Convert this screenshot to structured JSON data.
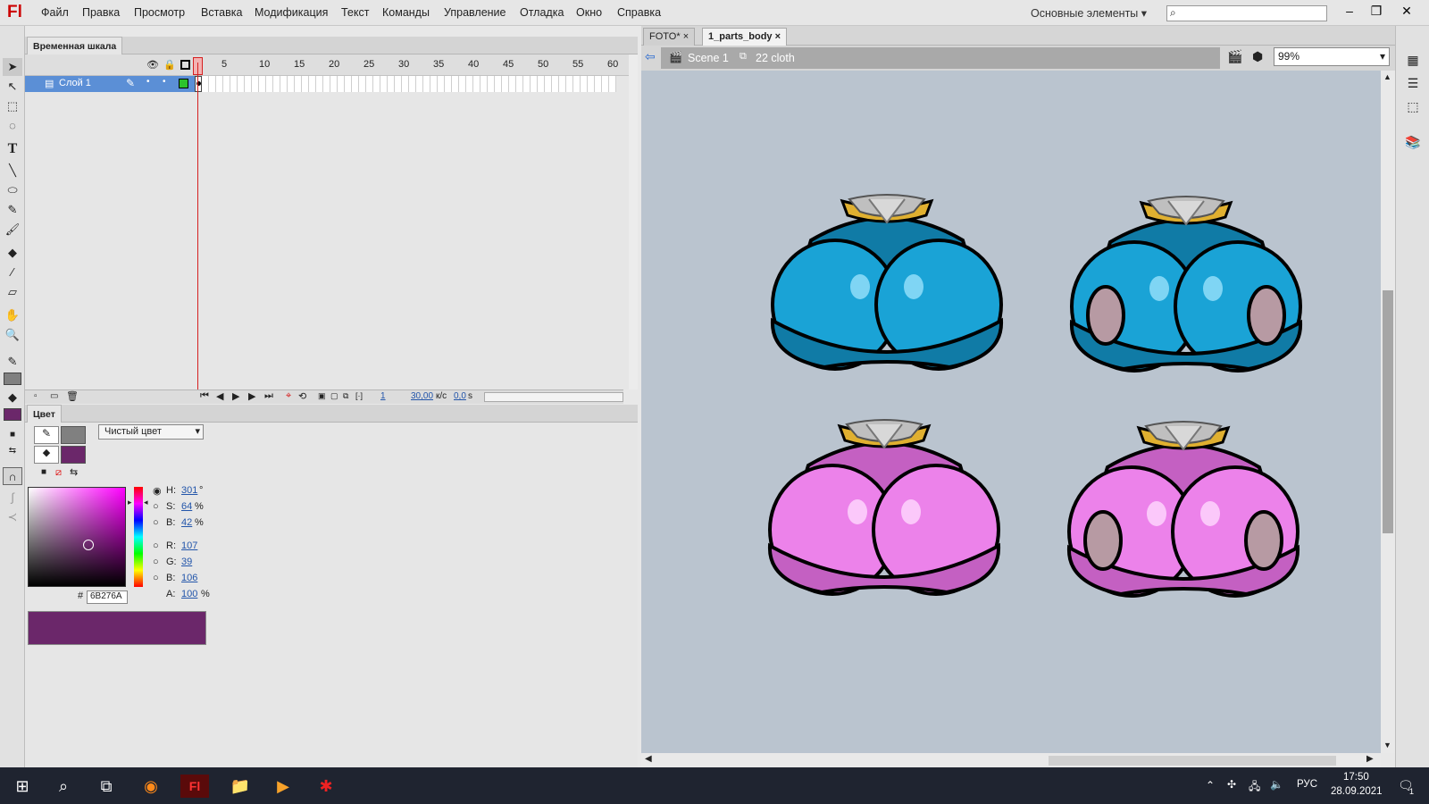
{
  "app": {
    "logo": "Fl",
    "menu": [
      "Файл",
      "Правка",
      "Просмотр",
      "Вставка",
      "Модификация",
      "Текст",
      "Команды",
      "Управление",
      "Отладка",
      "Окно",
      "Справка"
    ],
    "workspace_label": "Основные элементы",
    "search_icon": "⌕"
  },
  "timeline": {
    "tab_label": "Временная шкала",
    "layer_name": "Слой 1",
    "frame_numbers": [
      "1",
      "5",
      "10",
      "15",
      "20",
      "25",
      "30",
      "35",
      "40",
      "45",
      "50",
      "55",
      "60"
    ],
    "current_frame": "1",
    "fps": "30,00",
    "fps_unit": "к/с",
    "time": "0,0",
    "time_unit": "s"
  },
  "color_panel": {
    "tab_label": "Цвет",
    "fill_type": "Чистый цвет",
    "h": "301",
    "h_unit": "°",
    "s": "64",
    "s_unit": "%",
    "b": "42",
    "b_unit": "%",
    "r": "107",
    "g": "39",
    "bl": "106",
    "alpha": "100",
    "alpha_unit": "%",
    "hex": "6B276A",
    "hash": "#",
    "labels": {
      "h": "H:",
      "s": "S:",
      "b": "B:",
      "r": "R:",
      "g": "G:",
      "bl": "B:",
      "a": "A:"
    },
    "stroke_color": "#808080",
    "fill_color": "#6b276a"
  },
  "document": {
    "tabs": [
      {
        "label": "FOTO*"
      },
      {
        "label": "1_parts_body"
      }
    ],
    "close_glyph": "×",
    "scene": "Scene 1",
    "symbol": "22 cloth",
    "zoom": "99%"
  },
  "taskbar": {
    "lang": "РУС",
    "time": "17:50",
    "date": "28.09.2021",
    "notify_count": "1"
  },
  "colors": {
    "blue_main": "#1aa3d6",
    "blue_dark": "#107ba6",
    "pink_main": "#ec82ea",
    "pink_dark": "#c460c2"
  }
}
